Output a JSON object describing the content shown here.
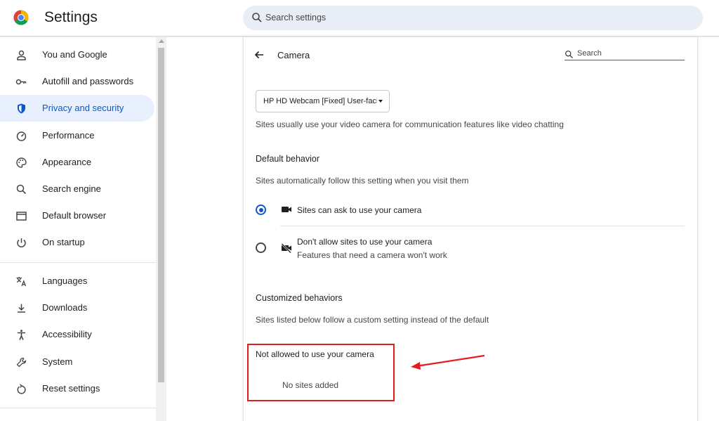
{
  "header": {
    "title": "Settings",
    "search_placeholder": "Search settings"
  },
  "sidebar": {
    "items": [
      {
        "label": "You and Google",
        "icon": "person-icon"
      },
      {
        "label": "Autofill and passwords",
        "icon": "key-icon"
      },
      {
        "label": "Privacy and security",
        "icon": "shield-icon",
        "active": true
      },
      {
        "label": "Performance",
        "icon": "speedometer-icon"
      },
      {
        "label": "Appearance",
        "icon": "palette-icon"
      },
      {
        "label": "Search engine",
        "icon": "search-icon"
      },
      {
        "label": "Default browser",
        "icon": "browser-window-icon"
      },
      {
        "label": "On startup",
        "icon": "power-icon"
      },
      {
        "label": "Languages",
        "icon": "translate-icon"
      },
      {
        "label": "Downloads",
        "icon": "download-icon"
      },
      {
        "label": "Accessibility",
        "icon": "accessibility-icon"
      },
      {
        "label": "System",
        "icon": "wrench-icon"
      },
      {
        "label": "Reset settings",
        "icon": "reset-icon"
      }
    ]
  },
  "page": {
    "title": "Camera",
    "search_label": "Search",
    "camera_select_value": "HP HD Webcam [Fixed] User-facing",
    "camera_description": "Sites usually use your video camera for communication features like video chatting",
    "default_behavior": {
      "heading": "Default behavior",
      "description": "Sites automatically follow this setting when you visit them",
      "options": [
        {
          "label": "Sites can ask to use your camera",
          "sublabel": "",
          "checked": true,
          "icon": "camera-icon"
        },
        {
          "label": "Don't allow sites to use your camera",
          "sublabel": "Features that need a camera won't work",
          "checked": false,
          "icon": "camera-off-icon"
        }
      ]
    },
    "customized_behaviors": {
      "heading": "Customized behaviors",
      "description": "Sites listed below follow a custom setting instead of the default",
      "not_allowed_heading": "Not allowed to use your camera",
      "empty_text": "No sites added"
    }
  },
  "colors": {
    "accent": "#0b57d0",
    "active_nav_bg": "#e8f0fe",
    "search_bg": "#e9eef6",
    "annotation": "#e61c1c"
  }
}
